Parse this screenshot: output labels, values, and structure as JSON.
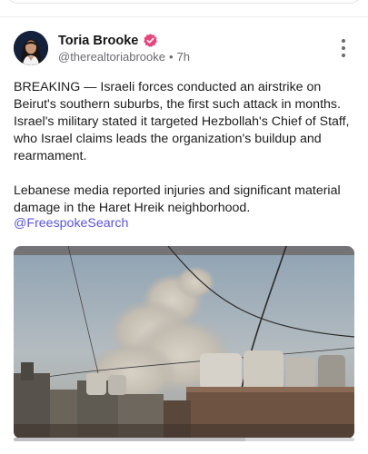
{
  "post": {
    "author_name": "Toria Brooke",
    "handle": "@therealtoriabrooke",
    "separator": "•",
    "time_ago": "7h",
    "body": "BREAKING — Israeli forces conducted an airstrike on Beirut's southern suburbs, the first such attack in months. Israel's military stated it targeted Hezbollah's Chief of Staff, who Israel claims leads the organization's buildup and rearmament.\n\nLebanese media reported injuries and significant material damage in the Haret Hreik neighborhood.",
    "mention": "@FreespokeSearch",
    "verified_color": "#e8457c",
    "link_color": "#5a55d6",
    "avatar_icon": "profile-photo",
    "menu_icon": "more-vertical-icon",
    "media_icon": "airstrike-smoke-video"
  }
}
